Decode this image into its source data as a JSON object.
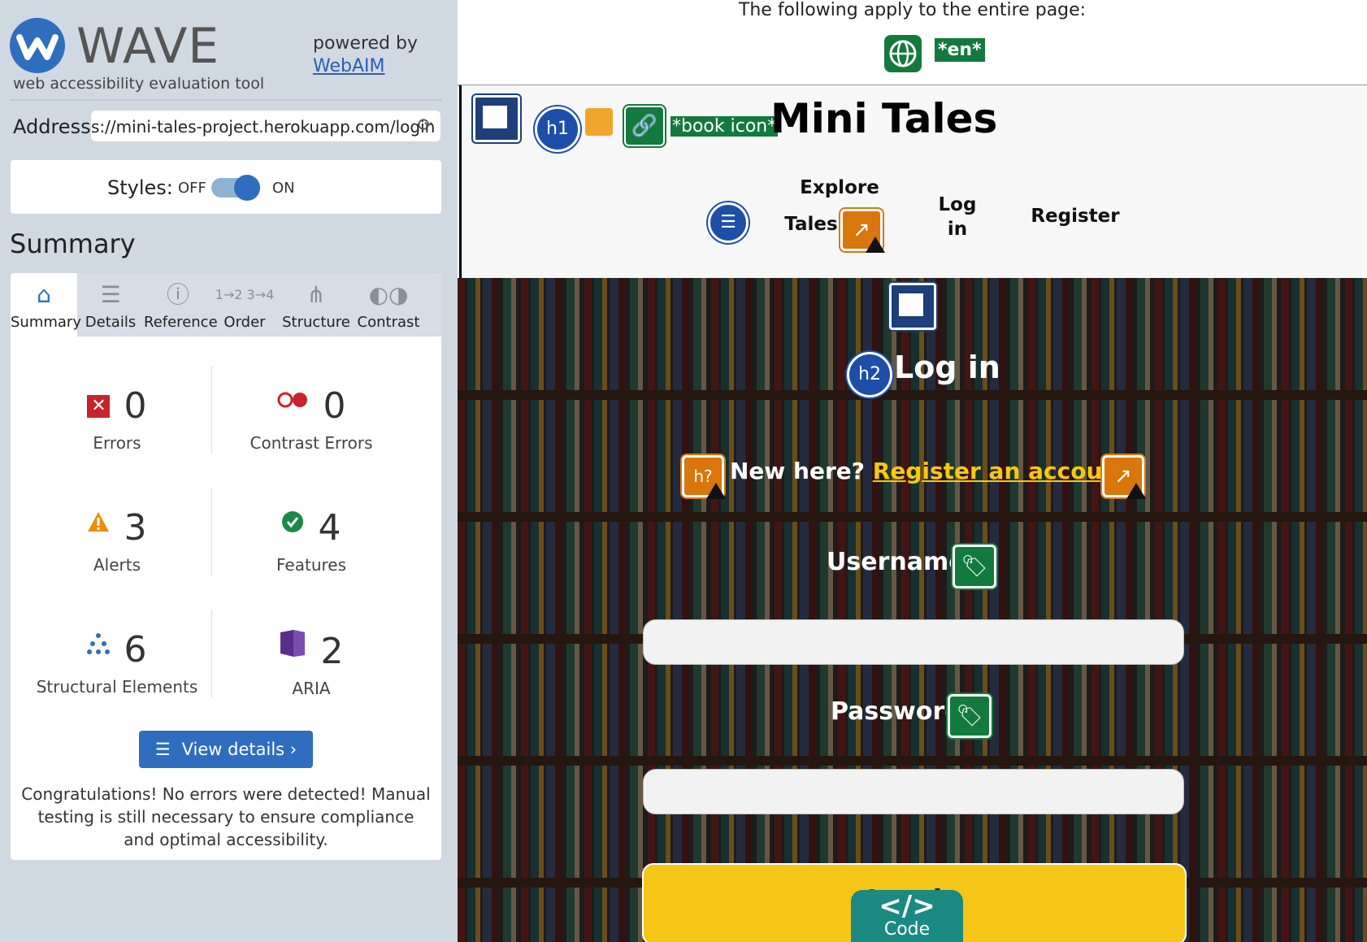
{
  "wave": {
    "logo_text": "WAVE",
    "subtitle": "web accessibility evaluation tool",
    "powered_by": "powered by",
    "webaim": "WebAIM",
    "address_label": "Address:",
    "address_value": "s://mini-tales-project.herokuapp.com/login",
    "styles_label": "Styles:",
    "styles_off": "OFF",
    "styles_on": "ON",
    "summary_title": "Summary",
    "tabs": [
      {
        "label": "Summary",
        "icon": "home-icon",
        "active": true
      },
      {
        "label": "Details",
        "icon": "list-icon",
        "active": false
      },
      {
        "label": "Reference",
        "icon": "info-icon",
        "active": false
      },
      {
        "label": "Order",
        "icon": "order-icon",
        "active": false
      },
      {
        "label": "Structure",
        "icon": "structure-icon",
        "active": false
      },
      {
        "label": "Contrast",
        "icon": "contrast-icon",
        "active": false
      }
    ],
    "stats": {
      "errors": {
        "count": "0",
        "label": "Errors"
      },
      "contrast_errors": {
        "count": "0",
        "label": "Contrast Errors"
      },
      "alerts": {
        "count": "3",
        "label": "Alerts"
      },
      "features": {
        "count": "4",
        "label": "Features"
      },
      "structural": {
        "count": "6",
        "label": "Structural Elements"
      },
      "aria": {
        "count": "2",
        "label": "ARIA"
      }
    },
    "view_details": "View details ›",
    "congrats": "Congratulations! No errors were detected! Manual testing is still necessary to ensure compliance and optimal accessibility."
  },
  "page": {
    "entire_page_note": "The following apply to the entire page:",
    "lang_badge": "*en*",
    "h1_badge": "h1",
    "book_icon_alt": "*book icon*",
    "site_title": "Mini Tales",
    "nav": {
      "explore": "Explore",
      "tales": "Tales",
      "login_1": "Log",
      "login_2": "in",
      "register": "Register"
    },
    "h2_badge": "h2",
    "login_heading": "Log in",
    "hq_badge": "h?",
    "new_here": "New here?",
    "register_link": "Register an account",
    "username_label": "Username",
    "password_label": "Password",
    "login_button": "Log in",
    "code_label": "Code",
    "code_icon": "</>"
  },
  "colors": {
    "wave_blue": "#2f6dbf",
    "feature_green": "#137a3d",
    "alert_orange": "#d9760c",
    "link_yellow": "#f7c810",
    "button_yellow": "#f5c518"
  }
}
